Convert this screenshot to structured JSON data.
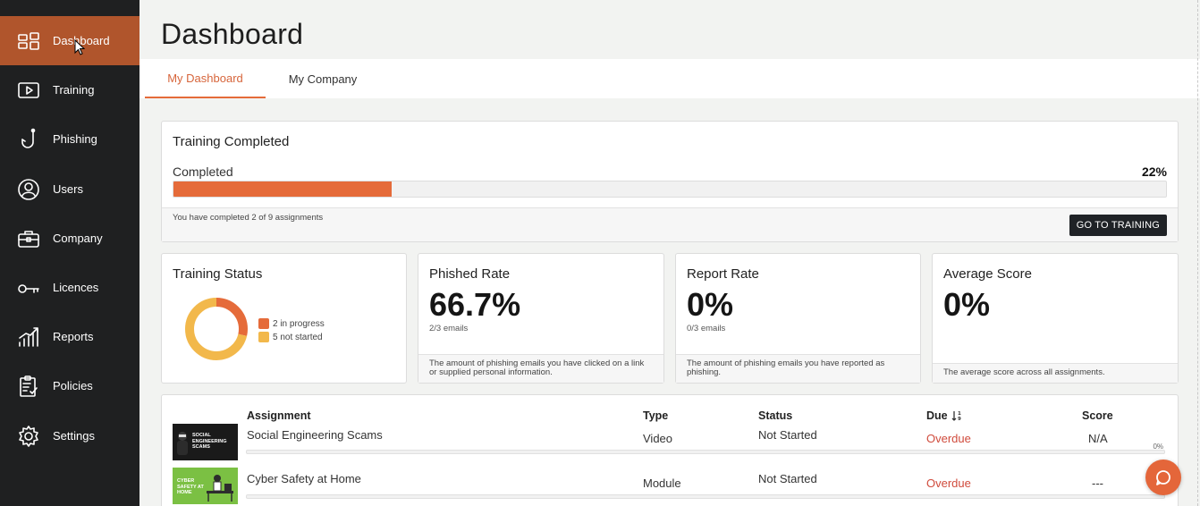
{
  "sidebar": {
    "items": [
      {
        "label": "Dashboard",
        "icon": "dashboard-icon",
        "active": true
      },
      {
        "label": "Training",
        "icon": "play-icon"
      },
      {
        "label": "Phishing",
        "icon": "hook-icon"
      },
      {
        "label": "Users",
        "icon": "user-icon"
      },
      {
        "label": "Company",
        "icon": "briefcase-icon"
      },
      {
        "label": "Licences",
        "icon": "key-icon"
      },
      {
        "label": "Reports",
        "icon": "chart-icon"
      },
      {
        "label": "Policies",
        "icon": "clipboard-icon"
      },
      {
        "label": "Settings",
        "icon": "gear-icon"
      }
    ]
  },
  "header": {
    "title": "Dashboard",
    "tabs": [
      {
        "label": "My Dashboard",
        "active": true
      },
      {
        "label": "My Company",
        "active": false
      }
    ]
  },
  "training_completed": {
    "title": "Training Completed",
    "progress_label": "Completed",
    "percent_text": "22%",
    "progress_fraction": 0.22,
    "note": "You have completed 2 of 9 assignments",
    "button": "GO TO TRAINING"
  },
  "training_status": {
    "title": "Training Status",
    "legend": [
      {
        "label": "2 in progress",
        "value": 2,
        "color": "#e56b3a"
      },
      {
        "label": "5 not started",
        "value": 5,
        "color": "#f2b84b"
      }
    ]
  },
  "phished_rate": {
    "title": "Phished Rate",
    "value": "66.7%",
    "sub": "2/3 emails",
    "desc": "The amount of phishing emails you have clicked on a link or supplied personal information."
  },
  "report_rate": {
    "title": "Report Rate",
    "value": "0%",
    "sub": "0/3 emails",
    "desc": "The amount of phishing emails you have reported as phishing."
  },
  "average_score": {
    "title": "Average Score",
    "value": "0%",
    "desc": "The average score across all assignments."
  },
  "assignments": {
    "headers": {
      "assignment": "Assignment",
      "type": "Type",
      "status": "Status",
      "due": "Due",
      "score": "Score"
    },
    "rows": [
      {
        "name": "Social Engineering Scams",
        "type": "Video",
        "status": "Not Started",
        "due": "Overdue",
        "score": "N/A",
        "progress": "0%",
        "thumb_text": "SOCIAL ENGINEERING SCAMS"
      },
      {
        "name": "Cyber Safety at Home",
        "type": "Module",
        "status": "Not Started",
        "due": "Overdue",
        "score": "---",
        "thumb_text": "CYBER SAFETY AT HOME"
      }
    ]
  },
  "colors": {
    "accent": "#e56b3a",
    "sidebar": "#1f2021",
    "active_nav": "#b0552c",
    "overdue": "#d04b3c"
  }
}
